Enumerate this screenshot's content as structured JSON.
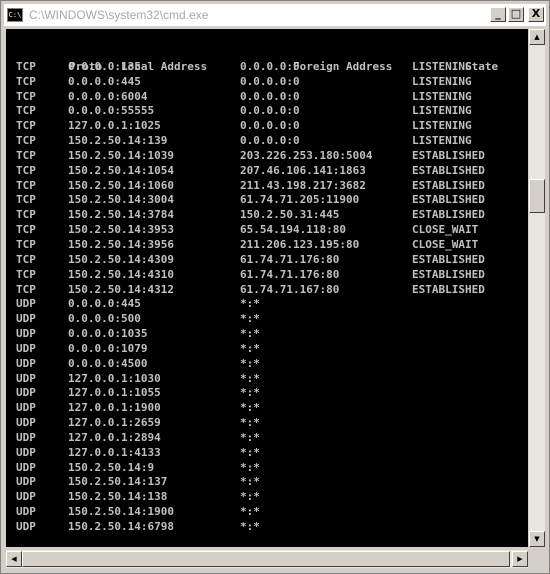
{
  "window": {
    "title": "C:\\WINDOWS\\system32\\cmd.exe",
    "icon_label": "C:\\",
    "controls": {
      "minimize": "_",
      "maximize": "□",
      "close": "X"
    }
  },
  "netstat": {
    "headers": {
      "proto": "Proto",
      "local": "Local Address",
      "foreign": "Foreign Address",
      "state": "State"
    },
    "rows": [
      {
        "proto": "TCP",
        "local": "0.0.0.0:135",
        "foreign": "0.0.0.0:0",
        "state": "LISTENING"
      },
      {
        "proto": "TCP",
        "local": "0.0.0.0:445",
        "foreign": "0.0.0.0:0",
        "state": "LISTENING"
      },
      {
        "proto": "TCP",
        "local": "0.0.0.0:6004",
        "foreign": "0.0.0.0:0",
        "state": "LISTENING"
      },
      {
        "proto": "TCP",
        "local": "0.0.0.0:55555",
        "foreign": "0.0.0.0:0",
        "state": "LISTENING"
      },
      {
        "proto": "TCP",
        "local": "127.0.0.1:1025",
        "foreign": "0.0.0.0:0",
        "state": "LISTENING"
      },
      {
        "proto": "TCP",
        "local": "150.2.50.14:139",
        "foreign": "0.0.0.0:0",
        "state": "LISTENING"
      },
      {
        "proto": "TCP",
        "local": "150.2.50.14:1039",
        "foreign": "203.226.253.180:5004",
        "state": "ESTABLISHED"
      },
      {
        "proto": "TCP",
        "local": "150.2.50.14:1054",
        "foreign": "207.46.106.141:1863",
        "state": "ESTABLISHED"
      },
      {
        "proto": "TCP",
        "local": "150.2.50.14:1060",
        "foreign": "211.43.198.217:3682",
        "state": "ESTABLISHED"
      },
      {
        "proto": "TCP",
        "local": "150.2.50.14:3004",
        "foreign": "61.74.71.205:11900",
        "state": "ESTABLISHED"
      },
      {
        "proto": "TCP",
        "local": "150.2.50.14:3784",
        "foreign": "150.2.50.31:445",
        "state": "ESTABLISHED"
      },
      {
        "proto": "TCP",
        "local": "150.2.50.14:3953",
        "foreign": "65.54.194.118:80",
        "state": "CLOSE_WAIT"
      },
      {
        "proto": "TCP",
        "local": "150.2.50.14:3956",
        "foreign": "211.206.123.195:80",
        "state": "CLOSE_WAIT"
      },
      {
        "proto": "TCP",
        "local": "150.2.50.14:4309",
        "foreign": "61.74.71.176:80",
        "state": "ESTABLISHED"
      },
      {
        "proto": "TCP",
        "local": "150.2.50.14:4310",
        "foreign": "61.74.71.176:80",
        "state": "ESTABLISHED"
      },
      {
        "proto": "TCP",
        "local": "150.2.50.14:4312",
        "foreign": "61.74.71.167:80",
        "state": "ESTABLISHED"
      },
      {
        "proto": "UDP",
        "local": "0.0.0.0:445",
        "foreign": "*:*",
        "state": ""
      },
      {
        "proto": "UDP",
        "local": "0.0.0.0:500",
        "foreign": "*:*",
        "state": ""
      },
      {
        "proto": "UDP",
        "local": "0.0.0.0:1035",
        "foreign": "*:*",
        "state": ""
      },
      {
        "proto": "UDP",
        "local": "0.0.0.0:1079",
        "foreign": "*:*",
        "state": ""
      },
      {
        "proto": "UDP",
        "local": "0.0.0.0:4500",
        "foreign": "*:*",
        "state": ""
      },
      {
        "proto": "UDP",
        "local": "127.0.0.1:1030",
        "foreign": "*:*",
        "state": ""
      },
      {
        "proto": "UDP",
        "local": "127.0.0.1:1055",
        "foreign": "*:*",
        "state": ""
      },
      {
        "proto": "UDP",
        "local": "127.0.0.1:1900",
        "foreign": "*:*",
        "state": ""
      },
      {
        "proto": "UDP",
        "local": "127.0.0.1:2659",
        "foreign": "*:*",
        "state": ""
      },
      {
        "proto": "UDP",
        "local": "127.0.0.1:2894",
        "foreign": "*:*",
        "state": ""
      },
      {
        "proto": "UDP",
        "local": "127.0.0.1:4133",
        "foreign": "*:*",
        "state": ""
      },
      {
        "proto": "UDP",
        "local": "150.2.50.14:9",
        "foreign": "*:*",
        "state": ""
      },
      {
        "proto": "UDP",
        "local": "150.2.50.14:137",
        "foreign": "*:*",
        "state": ""
      },
      {
        "proto": "UDP",
        "local": "150.2.50.14:138",
        "foreign": "*:*",
        "state": ""
      },
      {
        "proto": "UDP",
        "local": "150.2.50.14:1900",
        "foreign": "*:*",
        "state": ""
      },
      {
        "proto": "UDP",
        "local": "150.2.50.14:6798",
        "foreign": "*:*",
        "state": ""
      }
    ]
  },
  "scrollbars": {
    "up_arrow": "▲",
    "down_arrow": "▼",
    "left_arrow": "◀",
    "right_arrow": "▶"
  },
  "colors": {
    "console_bg": "#000000",
    "console_text": "#c0c0c0",
    "title_text": "#a8a8a8",
    "chrome": "#d4d0c8"
  }
}
